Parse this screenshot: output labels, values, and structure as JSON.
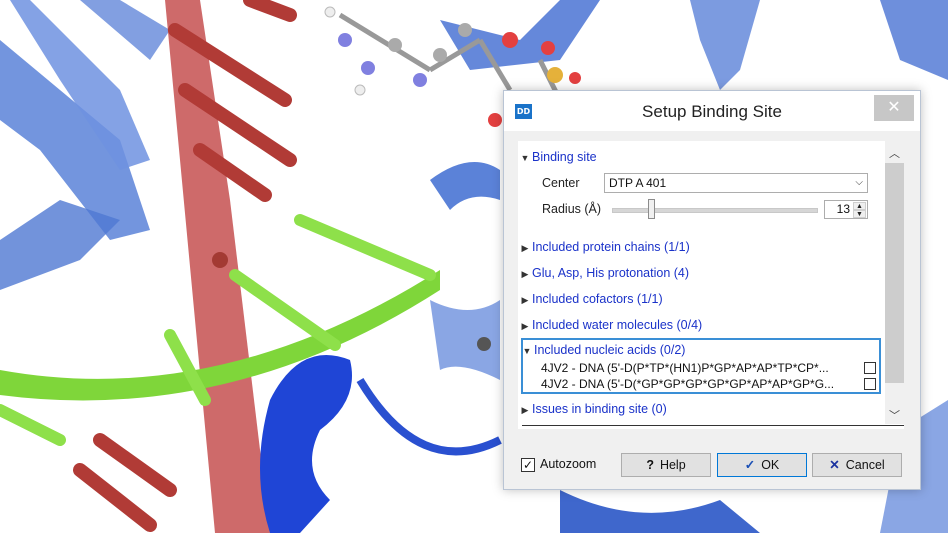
{
  "dialog": {
    "icon_text": "DD",
    "title": "Setup Binding Site",
    "close_glyph": "✕"
  },
  "binding_site": {
    "section_label": "Binding site",
    "center_label": "Center",
    "center_value": "DTP A 401",
    "radius_label": "Radius (Å)",
    "radius_value": "13"
  },
  "sections": {
    "protein_chains": "Included protein chains (1/1)",
    "protonation": "Glu, Asp, His protonation (4)",
    "cofactors": "Included cofactors (1/1)",
    "water": "Included water molecules (0/4)",
    "nucleic_acids": "Included nucleic acids (0/2)",
    "issues": "Issues in binding site (0)"
  },
  "nucleic_acids": [
    {
      "label": "4JV2 - DNA (5'-D(P*TP*(HN1)P*GP*AP*AP*TP*CP*...",
      "checked": false
    },
    {
      "label": "4JV2 - DNA (5'-D(*GP*GP*GP*GP*GP*AP*AP*GP*G...",
      "checked": false
    }
  ],
  "footer": {
    "autozoom_label": "Autozoom",
    "autozoom_checked": true,
    "help_label": "Help",
    "ok_label": "OK",
    "cancel_label": "Cancel"
  },
  "icons": {
    "check": "✓",
    "help": "?",
    "ok": "✓",
    "cancel": "✕",
    "expanded": "▼",
    "collapsed": "▶",
    "chevron_down": "⌵",
    "scroll_up": "︿",
    "scroll_down": "﹀"
  },
  "colors": {
    "section_text": "#1a32c9",
    "focus_border": "#3a8fd6",
    "titlebar_close": "#c7c7c7"
  }
}
